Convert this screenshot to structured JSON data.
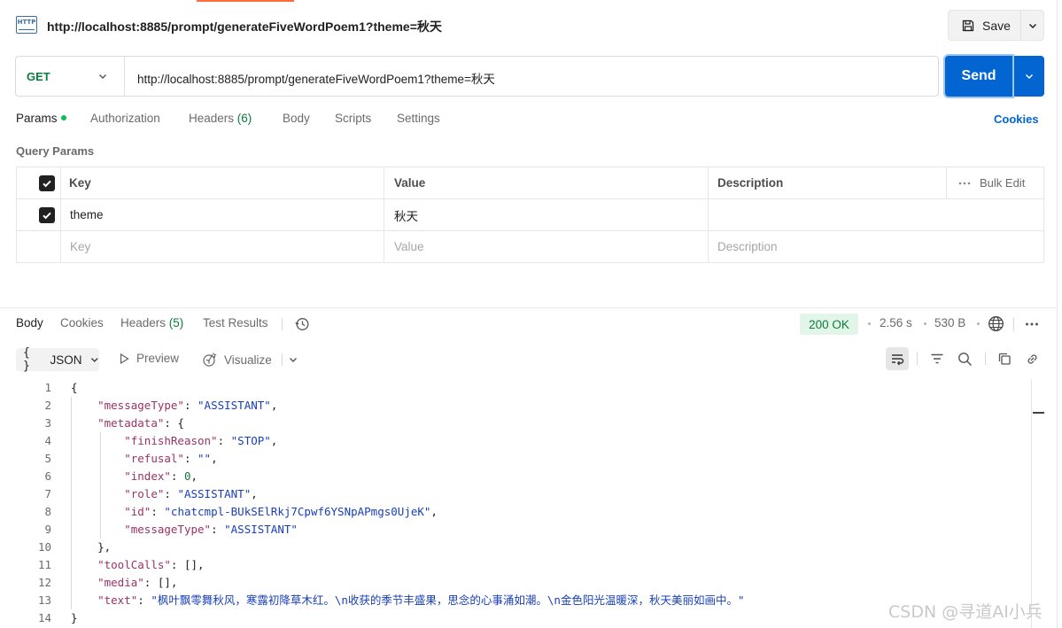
{
  "title_bar": {
    "icon": "http-icon",
    "title": "http://localhost:8885/prompt/generateFiveWordPoem1?theme=秋天",
    "save_label": "Save"
  },
  "request": {
    "method": "GET",
    "url": "http://localhost:8885/prompt/generateFiveWordPoem1?theme=秋天",
    "send_label": "Send"
  },
  "request_tabs": [
    {
      "label": "Params",
      "active": true
    },
    {
      "label": "Authorization"
    },
    {
      "label": "Headers",
      "count": "(6)"
    },
    {
      "label": "Body"
    },
    {
      "label": "Scripts"
    },
    {
      "label": "Settings"
    }
  ],
  "cookies_label": "Cookies",
  "query_params": {
    "title": "Query Params",
    "headers": {
      "key": "Key",
      "value": "Value",
      "description": "Description",
      "bulk_edit": "Bulk Edit"
    },
    "rows": [
      {
        "checked": true,
        "key": "theme",
        "value": "秋天",
        "description": ""
      }
    ],
    "placeholders": {
      "key": "Key",
      "value": "Value",
      "description": "Description"
    }
  },
  "response_tabs": [
    {
      "label": "Body",
      "active": true
    },
    {
      "label": "Cookies"
    },
    {
      "label": "Headers",
      "count": "(5)"
    },
    {
      "label": "Test Results"
    }
  ],
  "response_meta": {
    "status": "200 OK",
    "time": "2.56 s",
    "size": "530 B"
  },
  "response_toolbar": {
    "format_icon": "{ }",
    "format": "JSON",
    "preview": "Preview",
    "visualize": "Visualize"
  },
  "code_lines": [
    "{",
    "    \"messageType\": \"ASSISTANT\",",
    "    \"metadata\": {",
    "        \"finishReason\": \"STOP\",",
    "        \"refusal\": \"\",",
    "        \"index\": 0,",
    "        \"role\": \"ASSISTANT\",",
    "        \"id\": \"chatcmpl-BUkSElRkj7Cpwf6YSNpAPmgs0UjeK\",",
    "        \"messageType\": \"ASSISTANT\"",
    "    },",
    "    \"toolCalls\": [],",
    "    \"media\": [],",
    "    \"text\": \"枫叶飘零舞秋风，寒露初降草木红。\\n收获的季节丰盛果，思念的心事涌如潮。\\n金色阳光温暖深，秋天美丽如画中。\"",
    "}"
  ],
  "line_numbers": [
    "1",
    "2",
    "3",
    "4",
    "5",
    "6",
    "7",
    "8",
    "9",
    "10",
    "11",
    "12",
    "13",
    "14"
  ],
  "watermark": "CSDN @寻道AI小兵",
  "colors": {
    "send": "#0265d2",
    "method_get": "#0f7b3c",
    "status_ok_bg": "#e1f5e8",
    "json_key": "#993366",
    "json_string": "#1a40b8",
    "json_number": "#0f7b3c"
  }
}
